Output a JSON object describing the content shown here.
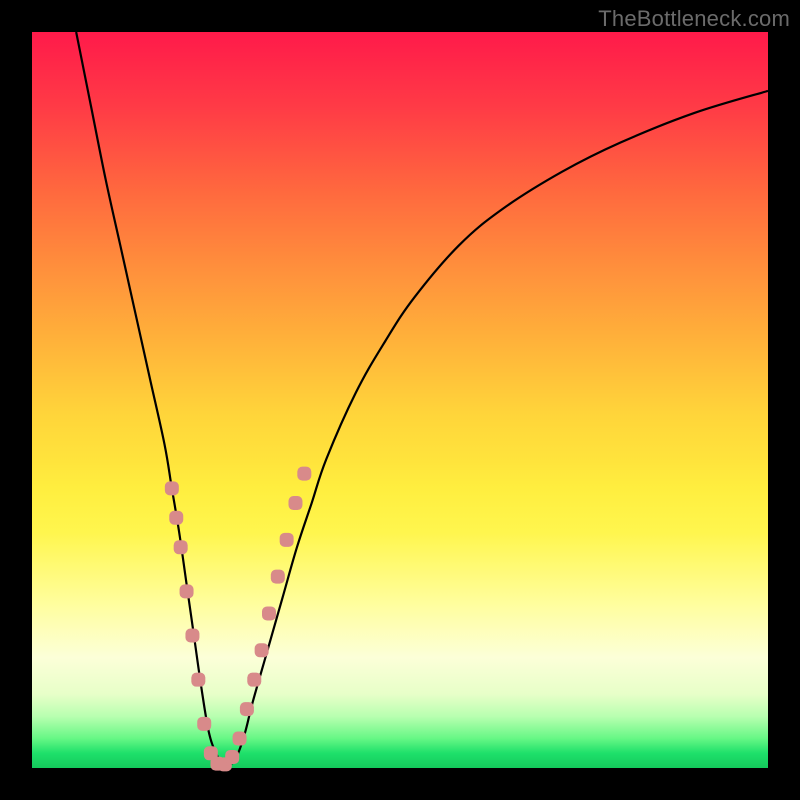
{
  "watermark": "TheBottleneck.com",
  "colors": {
    "frame": "#000000",
    "gradient_top": "#ff1a4a",
    "gradient_mid": "#ffe33c",
    "gradient_bottom": "#14c95c",
    "curve": "#000000",
    "marker": "#d88a8a"
  },
  "chart_data": {
    "type": "line",
    "title": "",
    "xlabel": "",
    "ylabel": "",
    "xlim": [
      0,
      100
    ],
    "ylim": [
      0,
      100
    ],
    "series": [
      {
        "name": "bottleneck-curve",
        "x": [
          6,
          8,
          10,
          12,
          14,
          16,
          18,
          19,
          20,
          21,
          22,
          23,
          24,
          25,
          26,
          27,
          28,
          29,
          30,
          32,
          34,
          36,
          38,
          40,
          44,
          48,
          52,
          58,
          64,
          72,
          80,
          90,
          100
        ],
        "y": [
          100,
          90,
          80,
          71,
          62,
          53,
          44,
          38,
          32,
          25,
          18,
          11,
          5,
          2,
          0.5,
          0.5,
          2,
          5,
          9,
          16,
          23,
          30,
          36,
          42,
          51,
          58,
          64,
          71,
          76,
          81,
          85,
          89,
          92
        ]
      }
    ],
    "markers": [
      {
        "x": 19.0,
        "y": 38
      },
      {
        "x": 19.6,
        "y": 34
      },
      {
        "x": 20.2,
        "y": 30
      },
      {
        "x": 21.0,
        "y": 24
      },
      {
        "x": 21.8,
        "y": 18
      },
      {
        "x": 22.6,
        "y": 12
      },
      {
        "x": 23.4,
        "y": 6
      },
      {
        "x": 24.3,
        "y": 2
      },
      {
        "x": 25.2,
        "y": 0.6
      },
      {
        "x": 26.2,
        "y": 0.5
      },
      {
        "x": 27.2,
        "y": 1.5
      },
      {
        "x": 28.2,
        "y": 4
      },
      {
        "x": 29.2,
        "y": 8
      },
      {
        "x": 30.2,
        "y": 12
      },
      {
        "x": 31.2,
        "y": 16
      },
      {
        "x": 32.2,
        "y": 21
      },
      {
        "x": 33.4,
        "y": 26
      },
      {
        "x": 34.6,
        "y": 31
      },
      {
        "x": 35.8,
        "y": 36
      },
      {
        "x": 37.0,
        "y": 40
      }
    ]
  }
}
